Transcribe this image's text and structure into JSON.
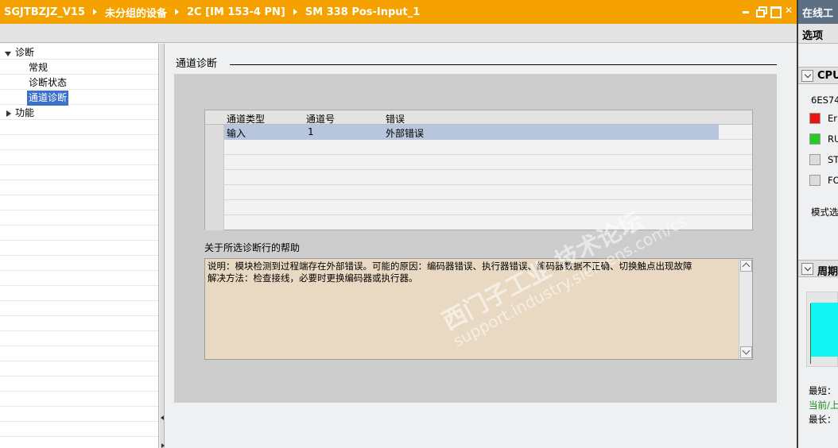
{
  "breadcrumb": [
    "SGJTBZJZ_V15",
    "未分组的设备",
    "2C [IM 153-4 PN]",
    "SM 338 Pos-Input_1"
  ],
  "tree": {
    "items": [
      {
        "label": "诊断",
        "level": 0,
        "expanded": true
      },
      {
        "label": "常规",
        "level": 1
      },
      {
        "label": "诊断状态",
        "level": 1
      },
      {
        "label": "通道诊断",
        "level": 1,
        "selected": true
      },
      {
        "label": "功能",
        "level": 0,
        "expanded": false
      }
    ]
  },
  "main": {
    "section_title": "通道诊断",
    "table": {
      "columns": [
        "通道类型",
        "通道号",
        "错误"
      ],
      "rows": [
        {
          "type": "输入",
          "channel": "1",
          "error": "外部错误"
        }
      ]
    },
    "help_label": "关于所选诊断行的帮助",
    "help_text": "说明：模块检测到过程端存在外部错误。可能的原因：编码器错误、执行器错误、编码器数据不正确、切换触点出现故障\n解决方法：检查接线，必要时更换编码器或执行器。"
  },
  "right": {
    "title": "在线工",
    "options": "选项",
    "cpu_section": "CPU",
    "order_no": "6ES74",
    "leds": [
      {
        "label": "Er",
        "color": "#ee1111"
      },
      {
        "label": "RU",
        "color": "#22cc22"
      },
      {
        "label": "ST",
        "color": "#dcdcdc"
      },
      {
        "label": "FO",
        "color": "#dcdcdc"
      }
    ],
    "mode_label": "模式选",
    "cycle_section": "周期",
    "shortest": "最短：",
    "current": "当前/上",
    "longest": "最长："
  },
  "watermark": {
    "line1": "西门子工业  技术论坛",
    "line2": "support.industry.siemens.com/cs"
  },
  "colors": {
    "titlebar": "#f5a100",
    "selection": "#3d71c9",
    "help_bg": "#e9d9c3"
  }
}
